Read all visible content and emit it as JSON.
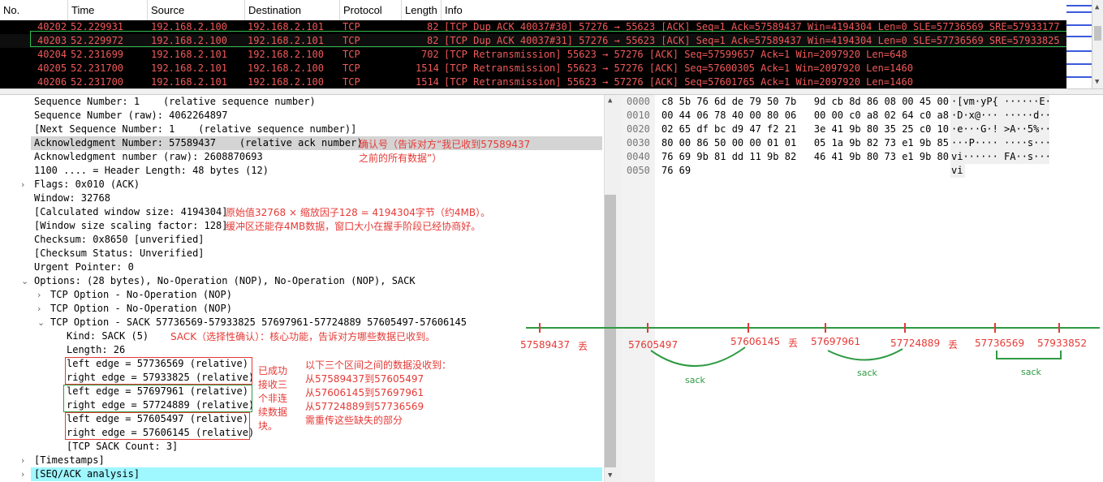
{
  "columns": [
    "No.",
    "Time",
    "Source",
    "Destination",
    "Protocol",
    "Length",
    "Info"
  ],
  "packets": [
    {
      "no": "40202",
      "time": "52.229931",
      "src": "192.168.2.100",
      "dst": "192.168.2.101",
      "proto": "TCP",
      "len": "82",
      "info": "[TCP Dup ACK 40037#30] 57276 → 55623 [ACK] Seq=1 Ack=57589437 Win=4194304 Len=0 SLE=57736569 SRE=57933177 SL…"
    },
    {
      "no": "40203",
      "time": "52.229972",
      "src": "192.168.2.100",
      "dst": "192.168.2.101",
      "proto": "TCP",
      "len": "82",
      "info": "[TCP Dup ACK 40037#31] 57276 → 55623 [ACK] Seq=1 Ack=57589437 Win=4194304 Len=0 SLE=57736569 SRE=57933825 SL…"
    },
    {
      "no": "40204",
      "time": "52.231699",
      "src": "192.168.2.101",
      "dst": "192.168.2.100",
      "proto": "TCP",
      "len": "702",
      "info": "[TCP Retransmission] 55623 → 57276 [ACK] Seq=57599657 Ack=1 Win=2097920 Len=648"
    },
    {
      "no": "40205",
      "time": "52.231700",
      "src": "192.168.2.101",
      "dst": "192.168.2.100",
      "proto": "TCP",
      "len": "1514",
      "info": "[TCP Retransmission] 55623 → 57276 [ACK] Seq=57600305 Ack=1 Win=2097920 Len=1460"
    },
    {
      "no": "40206",
      "time": "52.231700",
      "src": "192.168.2.101",
      "dst": "192.168.2.100",
      "proto": "TCP",
      "len": "1514",
      "info": "[TCP Retransmission] 55623 → 57276 [ACK] Seq=57601765 Ack=1 Win=2097920 Len=1460"
    }
  ],
  "details": [
    "Sequence Number: 1    (relative sequence number)",
    "Sequence Number (raw): 4062264897",
    "[Next Sequence Number: 1    (relative sequence number)]",
    "Acknowledgment Number: 57589437    (relative ack number)",
    "Acknowledgment number (raw): 2608870693",
    "1100 .... = Header Length: 48 bytes (12)",
    "Flags: 0x010 (ACK)",
    "Window: 32768",
    "[Calculated window size: 4194304]",
    "[Window size scaling factor: 128]",
    "Checksum: 0x8650 [unverified]",
    "[Checksum Status: Unverified]",
    "Urgent Pointer: 0",
    "Options: (28 bytes), No-Operation (NOP), No-Operation (NOP), SACK",
    "TCP Option - No-Operation (NOP)",
    "TCP Option - No-Operation (NOP)",
    "TCP Option - SACK 57736569-57933825 57697961-57724889 57605497-57606145",
    "Kind: SACK (5)",
    "Length: 26",
    "left edge = 57736569 (relative)",
    "right edge = 57933825 (relative)",
    "left edge = 57697961 (relative)",
    "right edge = 57724889 (relative)",
    "left edge = 57605497 (relative)",
    "right edge = 57606145 (relative)",
    "[TCP SACK Count: 3]",
    "[Timestamps]",
    "[SEQ/ACK analysis]"
  ],
  "notes": {
    "ack_line1": "确认号（告诉对方“我已收到57589437",
    "ack_line2": "之前的所有数据”）",
    "win_line1": "原始值32768 × 缩放因子128 = 4194304字节（约4MB）。",
    "win_line2": "缓冲区还能存4MB数据，窗口大小在握手阶段已经协商好。",
    "sack_kind": "SACK（选择性确认）：核心功能，告诉对方哪些数据已收到。",
    "received": "已成功\n接收三\n个非连\n续数据\n块。",
    "missing": "以下三个区间之间的数据没收到：\n从57589437到57605497\n从57606145到57697961\n从57724889到57736569\n需重传这些缺失的部分"
  },
  "hex": {
    "offsets": [
      "0000",
      "0010",
      "0020",
      "0030",
      "0040",
      "0050"
    ],
    "bytes": [
      "c8 5b 76 6d de 79 50 7b   9d cb 8d 86 08 00 45 00",
      "00 44 06 78 40 00 80 06   00 00 c0 a8 02 64 c0 a8",
      "02 65 df bc d9 47 f2 21   3e 41 9b 80 35 25 c0 10",
      "80 00 86 50 00 00 01 01   05 1a 9b 82 73 e1 9b 85",
      "76 69 9b 81 dd 11 9b 82   46 41 9b 80 73 e1 9b 80",
      "76 69"
    ],
    "ascii": [
      "·[vm·yP{ ······E·",
      "·D·x@··· ·····d··",
      "·e···G·! >A··5%··",
      "···P···· ····s···",
      "vi······ FA··s···",
      "vi"
    ]
  },
  "diagram": {
    "labels": [
      "57589437",
      "丢",
      "57605497",
      "57606145",
      "丢",
      "57697961",
      "57724889",
      "丢",
      "57736569",
      "57933852"
    ],
    "sack_label": "sack"
  }
}
